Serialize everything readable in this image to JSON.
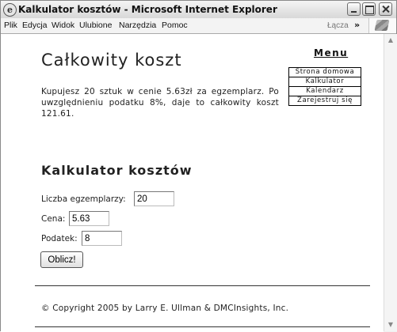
{
  "window": {
    "title": "Kalkulator kosztów - Microsoft Internet Explorer",
    "icon": "ie-page-icon"
  },
  "menubar": {
    "items": [
      "Plik",
      "Edycja",
      "Widok",
      "Ulubione",
      "Narzędzia",
      "Pomoc"
    ],
    "links_label": "Łącza",
    "chevron": "»"
  },
  "page": {
    "title": "Całkowity koszt",
    "intro": "Kupujesz 20 sztuk w cenie 5.63zł za egzemplarz. Po uwzględnieniu podatku 8%, daje to całkowity koszt 121.61.",
    "menu_heading": "Menu",
    "menu_items": [
      "Strona domowa",
      "Kalkulator",
      "Kalendarz",
      "Zarejestruj się"
    ],
    "calc_heading": "Kalkulator kosztów",
    "fields": {
      "quantity_label": "Liczba egzemplarzy:",
      "quantity_value": "20",
      "price_label": "Cena:",
      "price_value": "5.63",
      "tax_label": "Podatek:",
      "tax_value": "8"
    },
    "submit_label": "Oblicz!",
    "footer": "© Copyright 2005 by Larry E. Ullman & DMCInsights, Inc."
  }
}
